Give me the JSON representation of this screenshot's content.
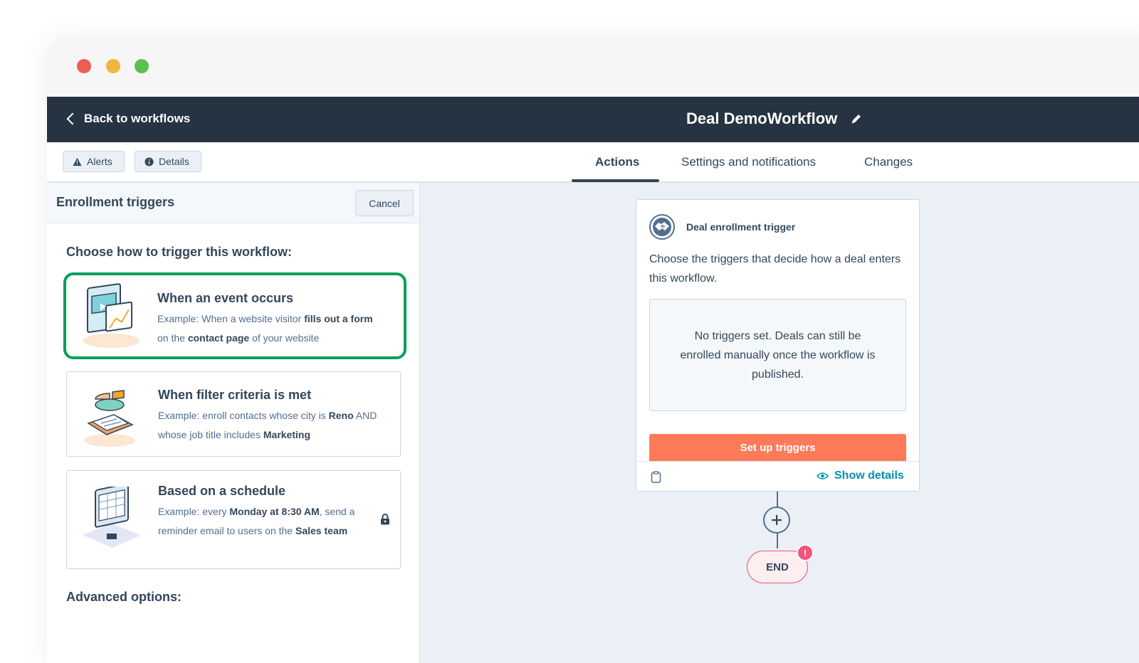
{
  "header": {
    "back_label": "Back to workflows",
    "workflow_title": "Deal DemoWorkflow"
  },
  "toolbar": {
    "alerts_label": "Alerts",
    "details_label": "Details"
  },
  "tabs": [
    {
      "label": "Actions",
      "active": true
    },
    {
      "label": "Settings and notifications",
      "active": false
    },
    {
      "label": "Changes",
      "active": false
    }
  ],
  "panel": {
    "title": "Enrollment triggers",
    "cancel_label": "Cancel",
    "choose_label": "Choose how to trigger this workflow:",
    "advanced_label": "Advanced options:",
    "options": [
      {
        "title": "When an event occurs",
        "selected": true,
        "desc": [
          {
            "t": "Example: When a website visitor ",
            "b": false
          },
          {
            "t": "fills out a form",
            "b": true
          },
          {
            "t": " on the ",
            "b": false
          },
          {
            "t": "contact page",
            "b": true
          },
          {
            "t": " of your website",
            "b": false
          }
        ]
      },
      {
        "title": "When filter criteria is met",
        "selected": false,
        "desc": [
          {
            "t": "Example: enroll contacts whose city is ",
            "b": false
          },
          {
            "t": "Reno",
            "b": true
          },
          {
            "t": " AND whose job title includes ",
            "b": false
          },
          {
            "t": "Marketing",
            "b": true
          }
        ]
      },
      {
        "title": "Based on a schedule",
        "selected": false,
        "locked": true,
        "desc": [
          {
            "t": "Example: every ",
            "b": false
          },
          {
            "t": "Monday at 8:30 AM",
            "b": true
          },
          {
            "t": ", send a reminder email to users on the ",
            "b": false
          },
          {
            "t": "Sales team",
            "b": true
          }
        ]
      }
    ]
  },
  "trigger_card": {
    "title": "Deal enrollment trigger",
    "text": "Choose the triggers that decide how a deal enters this workflow.",
    "empty_text": "No triggers set. Deals can still be enrolled manually once the workflow is published.",
    "setup_label": "Set up triggers",
    "show_details_label": "Show details"
  },
  "end_node": {
    "label": "END",
    "badge": "!"
  },
  "colors": {
    "topbar": "#253342",
    "accent_orange": "#ff7a59",
    "selected_border": "#00a05a",
    "link_teal": "#0091ae",
    "end_pink": "#f2547d"
  },
  "icons": [
    "chevron-left-icon",
    "pencil-icon",
    "warning-icon",
    "info-icon",
    "lock-icon",
    "handshake-icon",
    "clipboard-icon",
    "eye-icon",
    "plus-icon"
  ]
}
